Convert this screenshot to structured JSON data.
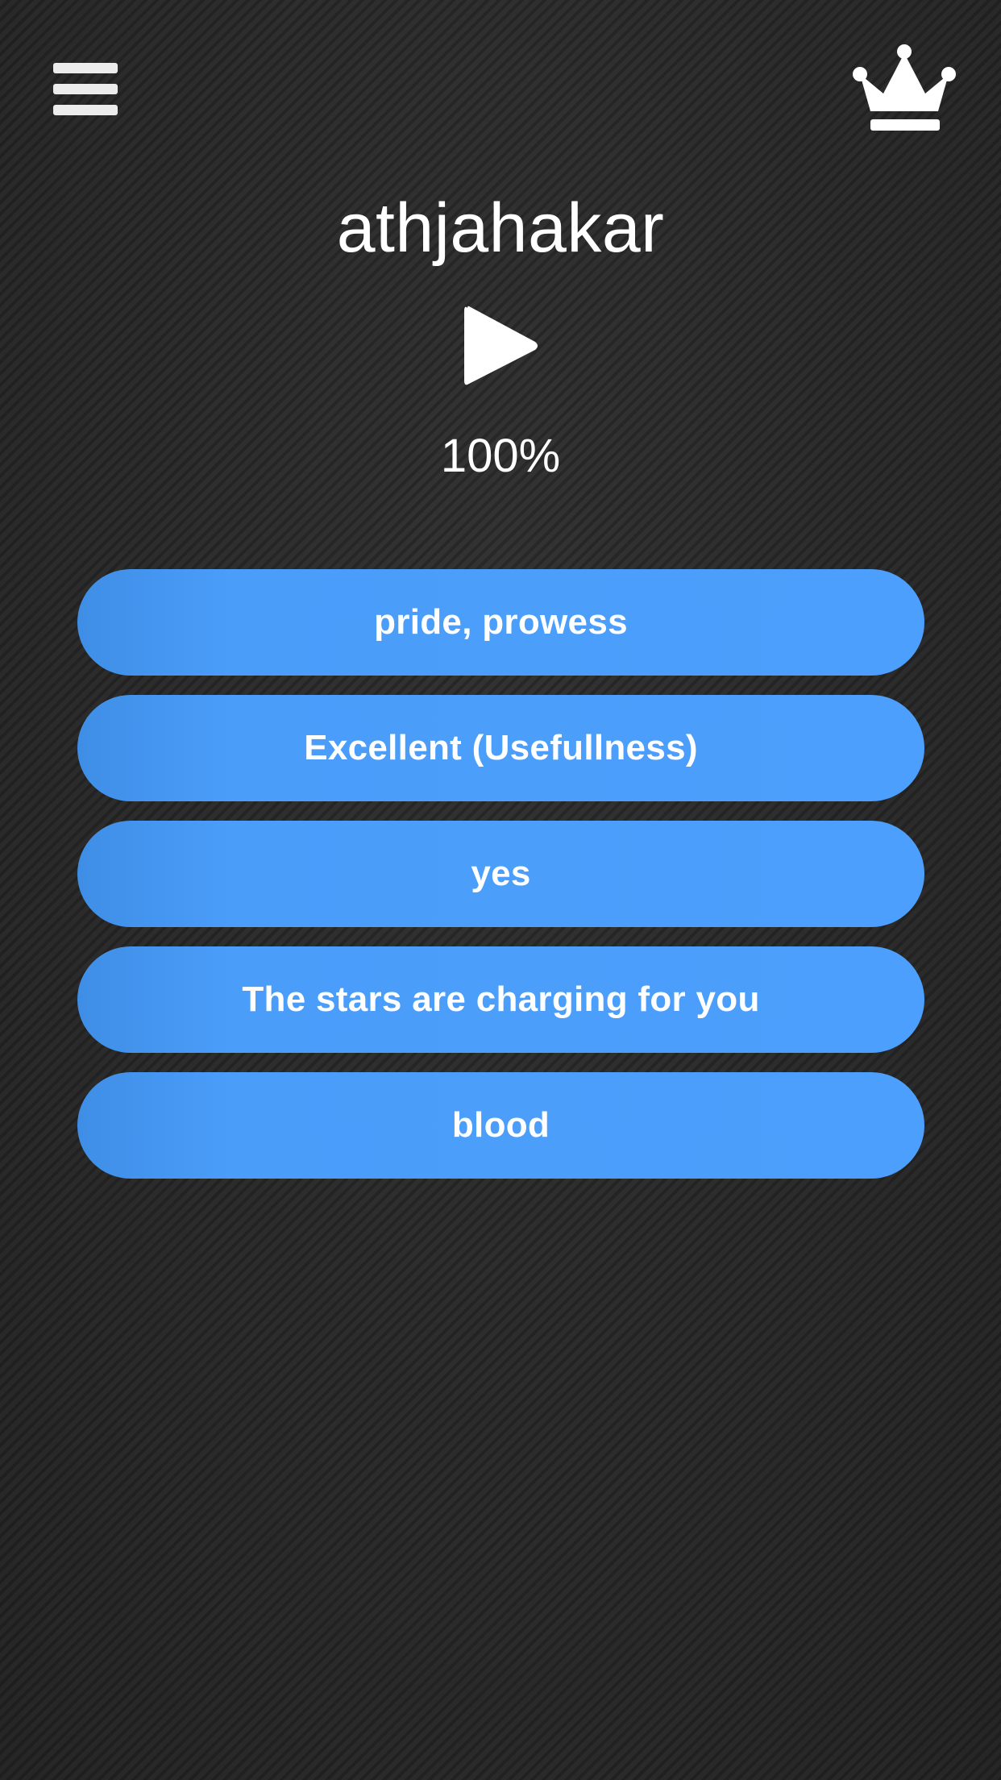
{
  "header": {
    "menu_icon": "hamburger-menu-icon",
    "leaderboard_icon": "crown-icon"
  },
  "quiz": {
    "word": "athjahakar",
    "play_icon": "play-icon",
    "progress_text": "100%",
    "options": [
      "pride, prowess",
      "Excellent (Usefullness)",
      "yes",
      "The stars are charging for you",
      "blood"
    ]
  },
  "colors": {
    "background": "#2b2b2b",
    "button": "#4c9ffc",
    "text": "#ffffff"
  }
}
